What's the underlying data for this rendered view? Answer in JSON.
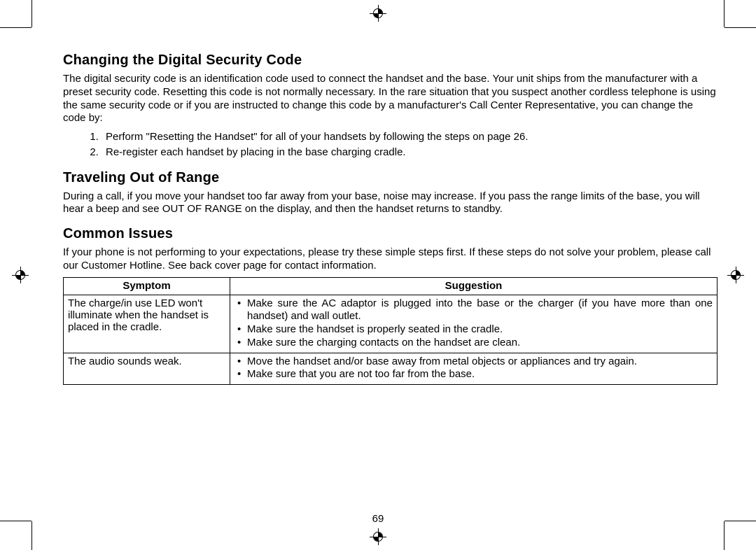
{
  "sections": {
    "s1": {
      "heading": "Changing the Digital Security Code",
      "body": "The digital security code is an identification code used to connect the handset and the base. Your unit ships from the manufacturer with a preset security code. Resetting this code is not normally necessary. In the rare situation that you suspect another cordless telephone is using the same security code or if you are instructed to change this code by a manufacturer's Call Center Representative, you can change the code by:",
      "steps": [
        "Perform \"Resetting the Handset\" for all of your handsets by following the steps on page 26.",
        "Re-register each handset by placing in the base charging cradle."
      ]
    },
    "s2": {
      "heading": "Traveling Out of Range",
      "body": "During a call, if you move your handset too far away from your base, noise may increase. If you pass the range limits of the base, you will hear a beep and see OUT OF RANGE on the display, and then the handset returns to standby."
    },
    "s3": {
      "heading": "Common Issues",
      "body": "If your phone is not performing to your expectations, please try these simple steps first. If these steps do not solve your problem, please call our Customer Hotline. See back cover page for contact information."
    }
  },
  "table": {
    "h1": "Symptom",
    "h2": "Suggestion",
    "r1_sym": "The charge/in use LED won't illuminate when the handset is placed in the cradle.",
    "r1_s1": "Make sure the AC adaptor is plugged into the base or the charger (if you have more than one handset) and wall outlet.",
    "r1_s2": "Make sure the handset is properly seated in the cradle.",
    "r1_s3": "Make sure the charging contacts on the handset are clean.",
    "r2_sym": "The audio sounds weak.",
    "r2_s1": "Move the handset and/or base away from metal objects or appliances and try again.",
    "r2_s2": "Make sure that you are not too far from the base."
  },
  "page_number": "69"
}
